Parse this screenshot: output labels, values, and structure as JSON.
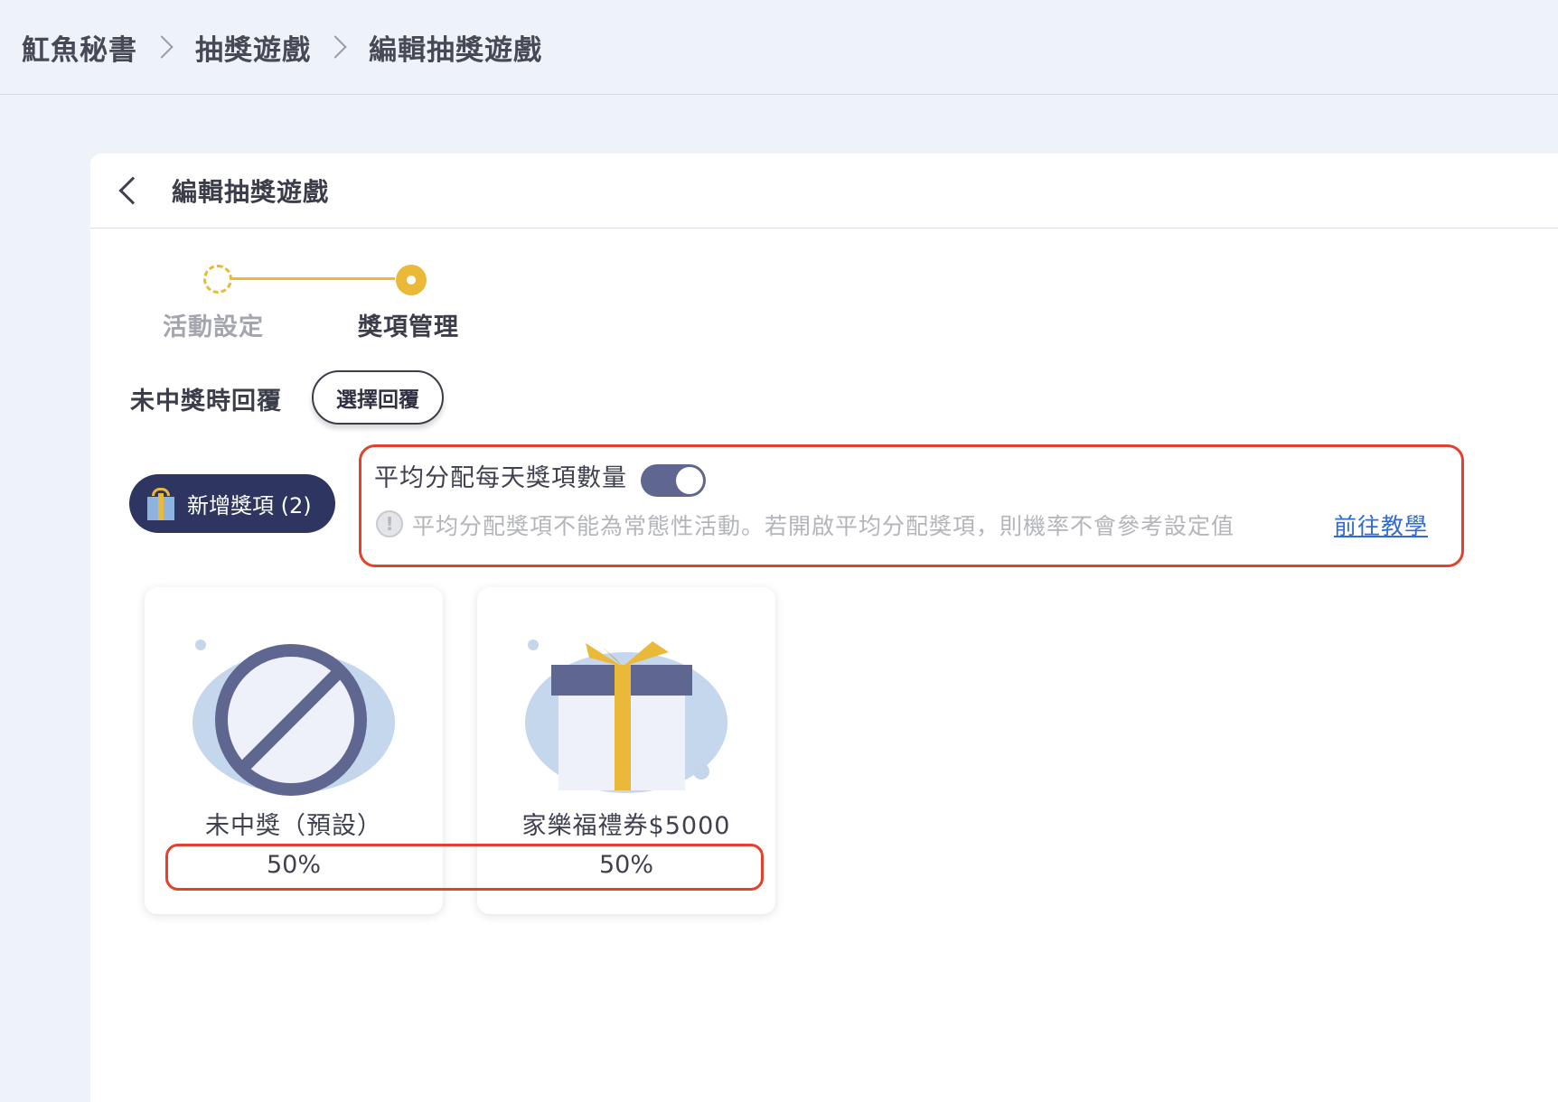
{
  "breadcrumb": {
    "items": [
      "魟魚秘書",
      "抽獎遊戲",
      "編輯抽獎遊戲"
    ]
  },
  "card": {
    "title": "編輯抽獎遊戲"
  },
  "stepper": {
    "steps": [
      {
        "label": "活動設定",
        "state": "done"
      },
      {
        "label": "獎項管理",
        "state": "active"
      }
    ]
  },
  "no_prize_reply": {
    "label": "未中獎時回覆",
    "button": "選擇回覆"
  },
  "add_prize": {
    "label": "新增獎項 (2)"
  },
  "average_distribution": {
    "label": "平均分配每天獎項數量",
    "enabled": true,
    "warning": "平均分配獎項不能為常態性活動。若開啟平均分配獎項，則機率不會參考設定值",
    "link": "前往教學"
  },
  "prizes": [
    {
      "name": "未中獎（預設）",
      "probability": "50%",
      "icon": "no-prize-icon"
    },
    {
      "name": "家樂福禮券$5000",
      "probability": "50%",
      "icon": "gift-icon"
    }
  ],
  "colors": {
    "accent": "#eab93a",
    "primary": "#2d3560",
    "toggle": "#5f6690",
    "highlight": "#e2412e",
    "link": "#2f6bd3"
  }
}
